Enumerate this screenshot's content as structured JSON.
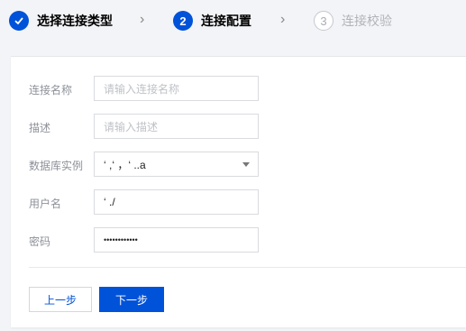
{
  "steps": [
    {
      "label": "选择连接类型",
      "number": "",
      "state": "done",
      "icon": "check-icon"
    },
    {
      "label": "连接配置",
      "number": "2",
      "state": "active"
    },
    {
      "label": "连接校验",
      "number": "3",
      "state": "todo"
    }
  ],
  "separator_icon": "chevron-right-icon",
  "form": {
    "name": {
      "label": "连接名称",
      "placeholder": "请输入连接名称",
      "value": ""
    },
    "description": {
      "label": "描述",
      "placeholder": "请输入描述",
      "value": ""
    },
    "instance": {
      "label": "数据库实例",
      "value": "‘ ,‘ ，‘   ..a",
      "icon": "caret-down-icon"
    },
    "username": {
      "label": "用户名",
      "value": "‘ ./"
    },
    "password": {
      "label": "密码",
      "value": "••••••••••••"
    }
  },
  "buttons": {
    "prev": "上一步",
    "next": "下一步"
  },
  "colors": {
    "primary": "#0052d9",
    "background": "#f3f4f7",
    "label": "#8d9199"
  }
}
